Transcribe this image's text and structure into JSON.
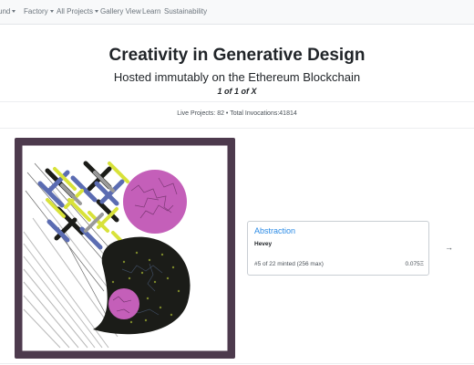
{
  "nav": {
    "items": [
      {
        "label": "und",
        "dropdown": true
      },
      {
        "label": "Factory",
        "dropdown": true
      },
      {
        "label": "All Projects",
        "dropdown": true
      },
      {
        "label": "Gallery View",
        "dropdown": false
      },
      {
        "label": "Learn",
        "dropdown": false
      },
      {
        "label": "Sustainability",
        "dropdown": false
      }
    ]
  },
  "hero": {
    "title": "Creativity in Generative Design",
    "subtitle": "Hosted immutably on the Ethereum Blockchain",
    "count": "1 of 1 of X"
  },
  "stats": "Live Projects: 82 • Total Invocations:41814",
  "featured": {
    "title": "Abstraction",
    "artist": "Hevey",
    "minted": "#5 of 22 minted (256 max)",
    "price": "0.075Ξ",
    "next_icon": "arrow-right-icon"
  },
  "colors": {
    "navbar_bg": "#f8f9fa",
    "frame": "#4d3a4d",
    "link": "#2b8be6",
    "artwork_pink": "#c45fb9",
    "artwork_dark": "#1b1c18",
    "artwork_yellow": "#d8e23a",
    "artwork_blue": "#5b6cb2"
  }
}
